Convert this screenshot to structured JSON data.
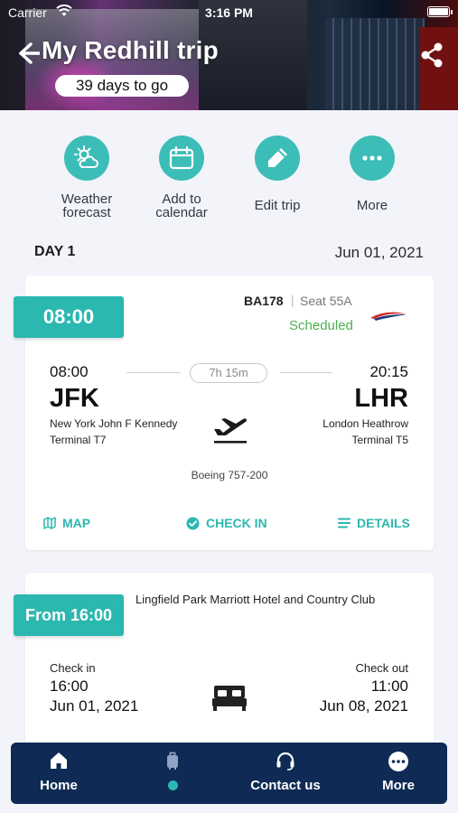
{
  "status_bar": {
    "carrier": "Carrier",
    "time": "3:16 PM"
  },
  "header": {
    "title": "My Redhill trip",
    "countdown": "39 days to go"
  },
  "actions": [
    {
      "label": "Weather\nforecast",
      "icon": "weather-icon"
    },
    {
      "label": "Add to\ncalendar",
      "icon": "calendar-icon"
    },
    {
      "label": "Edit trip",
      "icon": "pencil-icon"
    },
    {
      "label": "More",
      "icon": "more-icon"
    }
  ],
  "day": {
    "label": "DAY 1",
    "date": "Jun 01, 2021"
  },
  "flight": {
    "time_tag": "08:00",
    "flight_number": "BA178",
    "separator": "|",
    "seat": "Seat 55A",
    "status": "Scheduled",
    "departure": {
      "time": "08:00",
      "code": "JFK",
      "name": "New York John F Kennedy",
      "terminal": "Terminal T7"
    },
    "arrival": {
      "time": "20:15",
      "code": "LHR",
      "name": "London Heathrow",
      "terminal": "Terminal T5"
    },
    "duration": "7h 15m",
    "aircraft": "Boeing 757-200",
    "actions": {
      "map": "MAP",
      "check_in": "CHECK IN",
      "details": "DETAILS"
    },
    "colors": {
      "accent": "#2bb8b0",
      "status": "#4caf50"
    }
  },
  "hotel": {
    "time_tag": "From 16:00",
    "name": "Lingfield Park Marriott Hotel and Country Club",
    "check_in": {
      "label": "Check in",
      "time": "16:00",
      "date": "Jun 01, 2021"
    },
    "check_out": {
      "label": "Check out",
      "time": "11:00",
      "date": "Jun 08, 2021"
    }
  },
  "bottom_nav": {
    "items": [
      {
        "label": "Home",
        "icon": "home-icon"
      },
      {
        "label": "",
        "icon": "luggage-icon",
        "active": true
      },
      {
        "label": "Contact us",
        "icon": "headset-icon"
      },
      {
        "label": "More",
        "icon": "more-icon"
      }
    ],
    "background": "#0e2a55"
  }
}
